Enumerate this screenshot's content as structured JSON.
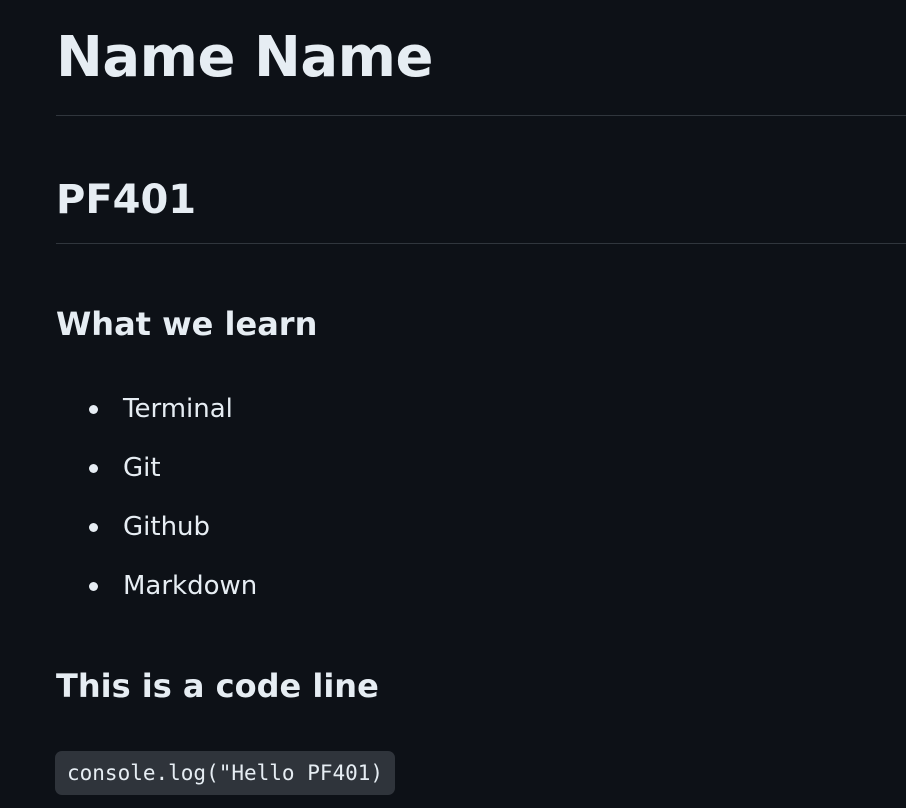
{
  "document": {
    "title": "Name Name",
    "course": "PF401",
    "learn_heading": "What we learn",
    "topics": [
      {
        "label": "Terminal"
      },
      {
        "label": "Git"
      },
      {
        "label": "Github"
      },
      {
        "label": "Markdown"
      }
    ],
    "code_heading": "This is a code line",
    "code": "console.log(\"Hello PF401)"
  },
  "colors": {
    "background": "#0d1117",
    "text": "#e6edf3",
    "divider": "#30363d",
    "code_background": "#2f343b"
  }
}
